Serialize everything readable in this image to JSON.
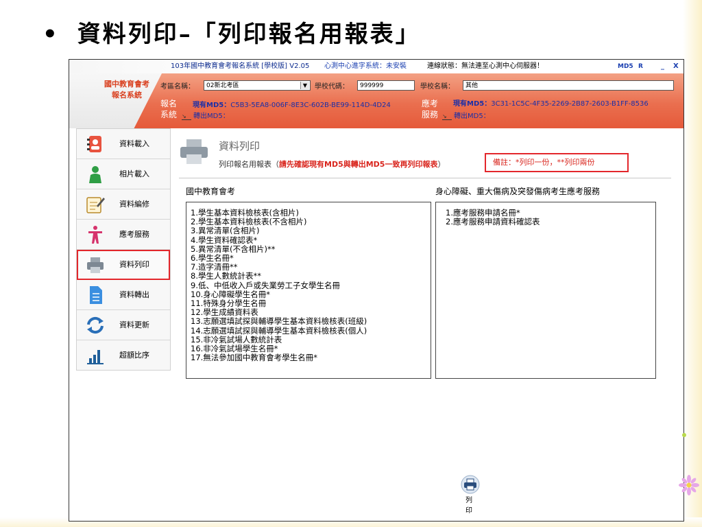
{
  "slide": {
    "bullet": "•",
    "title": "資料列印–「列印報名用報表」"
  },
  "titlebar": {
    "app_title": "103年國中教育會考報名系統 [學校版] V2.05",
    "center_status": "心測中心進字系統：未安裝",
    "connection_status": "連線狀態：無法連至心測中心伺服器！",
    "md5_btn": "MD5",
    "r_btn": "R",
    "minimize": "_",
    "close": "X"
  },
  "header": {
    "logo_line1": "國中教育會考",
    "logo_line2": "報名系統",
    "district_label": "考區名稱：",
    "district_value": "02新北考區",
    "school_code_label": "學校代碼：",
    "school_code_value": "999999",
    "school_name_label": "學校名稱：",
    "school_name_value": "其他",
    "reg_label_1": "報名",
    "reg_label_2": "系統",
    "reg_md5_label": "現有MD5：",
    "reg_md5_value": "C5B3-5EA8-006F-8E3C-602B-BE99-114D-4D24",
    "reg_out_label": "轉出MD5：",
    "svc_label_1": "應考",
    "svc_label_2": "服務",
    "svc_md5_label": "現有MD5：",
    "svc_md5_value": "3C31-1C5C-4F35-2269-2B87-2603-B1FF-8536",
    "svc_out_label": "轉出MD5："
  },
  "sidebar": {
    "items": [
      {
        "label": "資料載入",
        "icon": "address-book-icon",
        "active": false
      },
      {
        "label": "相片載入",
        "icon": "person-icon",
        "active": false
      },
      {
        "label": "資料編修",
        "icon": "edit-document-icon",
        "active": false
      },
      {
        "label": "應考服務",
        "icon": "accessibility-icon",
        "active": false
      },
      {
        "label": "資料列印",
        "icon": "printer-icon",
        "active": true
      },
      {
        "label": "資料轉出",
        "icon": "document-icon",
        "active": false
      },
      {
        "label": "資料更新",
        "icon": "refresh-icon",
        "active": false
      },
      {
        "label": "超額比序",
        "icon": "bar-chart-icon",
        "active": false
      }
    ]
  },
  "main": {
    "page_title": "資料列印",
    "subtitle_prefix": "列印報名用報表（",
    "subtitle_warning": "請先確認現有MD5與轉出MD5一致再列印報表",
    "subtitle_suffix": "）",
    "memo": "備註：*列印一份，**列印兩份",
    "section1_title": "國中教育會考",
    "section2_title": "身心障礙、重大傷病及突發傷病考生應考服務",
    "list1": [
      " 1.學生基本資料檢核表(含相片)",
      " 2.學生基本資料檢核表(不含相片)",
      " 3.異常清單(含相片)",
      " 4.學生資料確認表*",
      " 5.異常清單(不含相片)**",
      " 6.學生名冊*",
      " 7.造字清冊**",
      " 8.學生人數統計表**",
      " 9.低、中低收入戶或失業勞工子女學生名冊",
      "10.身心障礙學生名冊*",
      "11.特殊身分學生名冊",
      "12.學生成績資料表",
      "13.志願選填試探與輔導學生基本資料檢核表(班級)",
      "14.志願選填試探與輔導學生基本資料檢核表(個人)",
      "15.非冷氣試場人數統計表",
      "16.非冷氣試場學生名冊*",
      "17.無法參加國中教育會考學生名冊*"
    ],
    "list2": [
      "1.應考服務申請名冊*",
      "2.應考服務申請資料確認表"
    ],
    "print_label": "列 印",
    "print_label_2": "列 印"
  },
  "colors": {
    "header_orange": "#e8654a",
    "accent_red": "#e3262b",
    "link_blue": "#1a2fa8"
  }
}
